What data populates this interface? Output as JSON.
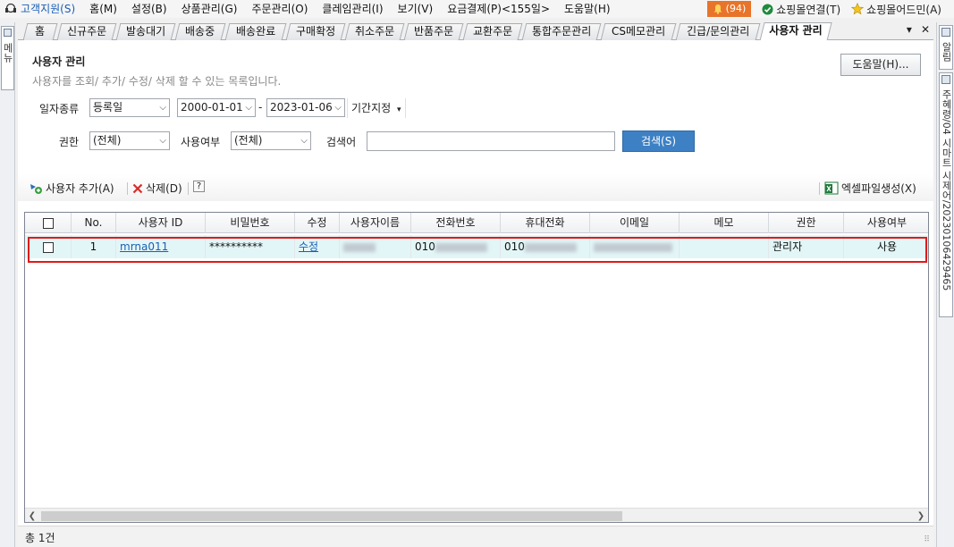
{
  "menubar": {
    "support": "고객지원(S)",
    "items": [
      "홈(M)",
      "설정(B)",
      "상품관리(G)",
      "주문관리(O)",
      "클레임관리(I)",
      "보기(V)",
      "요금결제(P)<155일>",
      "도움말(H)"
    ],
    "alert_count": "(94)",
    "mall_connect": "쇼핑몰연결(T)",
    "mall_admin": "쇼핑몰어드민(A)"
  },
  "left_rail": {
    "label": "메뉴"
  },
  "right_rail": {
    "alert": "알림",
    "history": "주혜령/04 시마트 시제어/20230106429465"
  },
  "tabs": [
    "홈",
    "신규주문",
    "발송대기",
    "배송중",
    "배송완료",
    "구매확정",
    "취소주문",
    "반품주문",
    "교환주문",
    "통합주문관리",
    "CS메모관리",
    "긴급/문의관리",
    "사용자 관리"
  ],
  "tab_controls": {
    "dropdown": "▾",
    "close": "✕"
  },
  "page": {
    "title": "사용자 관리",
    "description": "사용자를 조회/ 추가/ 수정/ 삭제 할 수 있는 목록입니다.",
    "help_button": "도움말(H)..."
  },
  "filters": {
    "date_type_label": "일자종류",
    "date_type_value": "등록일",
    "date_from": "2000-01-01",
    "date_sep": "-",
    "date_to": "2023-01-06",
    "period_label": "기간지정",
    "role_label": "권한",
    "role_value": "(전체)",
    "usage_label": "사용여부",
    "usage_value": "(전체)",
    "keyword_label": "검색어",
    "keyword_value": "",
    "search_button": "검색(S)"
  },
  "toolbar": {
    "add_user": "사용자 추가(A)",
    "delete": "삭제(D)",
    "help": "?",
    "export_excel": "엑셀파일생성(X)"
  },
  "grid": {
    "columns": [
      "No.",
      "사용자 ID",
      "비밀번호",
      "수정",
      "사용자이름",
      "전화번호",
      "휴대전화",
      "이메일",
      "메모",
      "권한",
      "사용여부"
    ],
    "rows": [
      {
        "no": "1",
        "user_id": "mrna011",
        "password": "**********",
        "edit": "수정",
        "name": "",
        "phone": "010",
        "mobile": "010",
        "email": "",
        "memo": "",
        "role": "관리자",
        "usage": "사용"
      }
    ]
  },
  "status": {
    "total": "총 1건"
  }
}
